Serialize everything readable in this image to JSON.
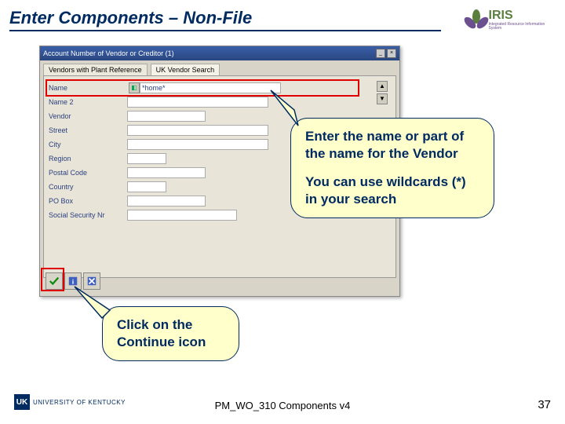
{
  "header": {
    "title": "Enter Components – Non-File",
    "brand": "IRIS",
    "brand_sub": "Integrated Resource Information System"
  },
  "window": {
    "title": "Account Number of Vendor or Creditor (1)",
    "tabs": [
      "Vendors with Plant Reference",
      "UK Vendor Search"
    ],
    "fields": {
      "name_label": "Name",
      "name_value": "*home*",
      "name2_label": "Name 2",
      "vendor_label": "Vendor",
      "street_label": "Street",
      "city_label": "City",
      "region_label": "Region",
      "postal_label": "Postal Code",
      "country_label": "Country",
      "pobox_label": "PO Box",
      "ssn_label": "Social Security Nr"
    },
    "scroll_up": "▲",
    "scroll_dn": "▼",
    "lookup_glyph": "◧"
  },
  "toolbar": {
    "continue_title": "Continue",
    "info_title": "Info",
    "close_title": "Close"
  },
  "callouts": {
    "big_line1": "Enter the name or part of the name for the Vendor",
    "big_line2": "You can use wildcards (*) in your search",
    "small": "Click on the Continue icon"
  },
  "footer": {
    "uk_badge": "UK",
    "uk_text": "UNIVERSITY OF KENTUCKY",
    "center": "PM_WO_310 Components v4",
    "page": "37"
  }
}
